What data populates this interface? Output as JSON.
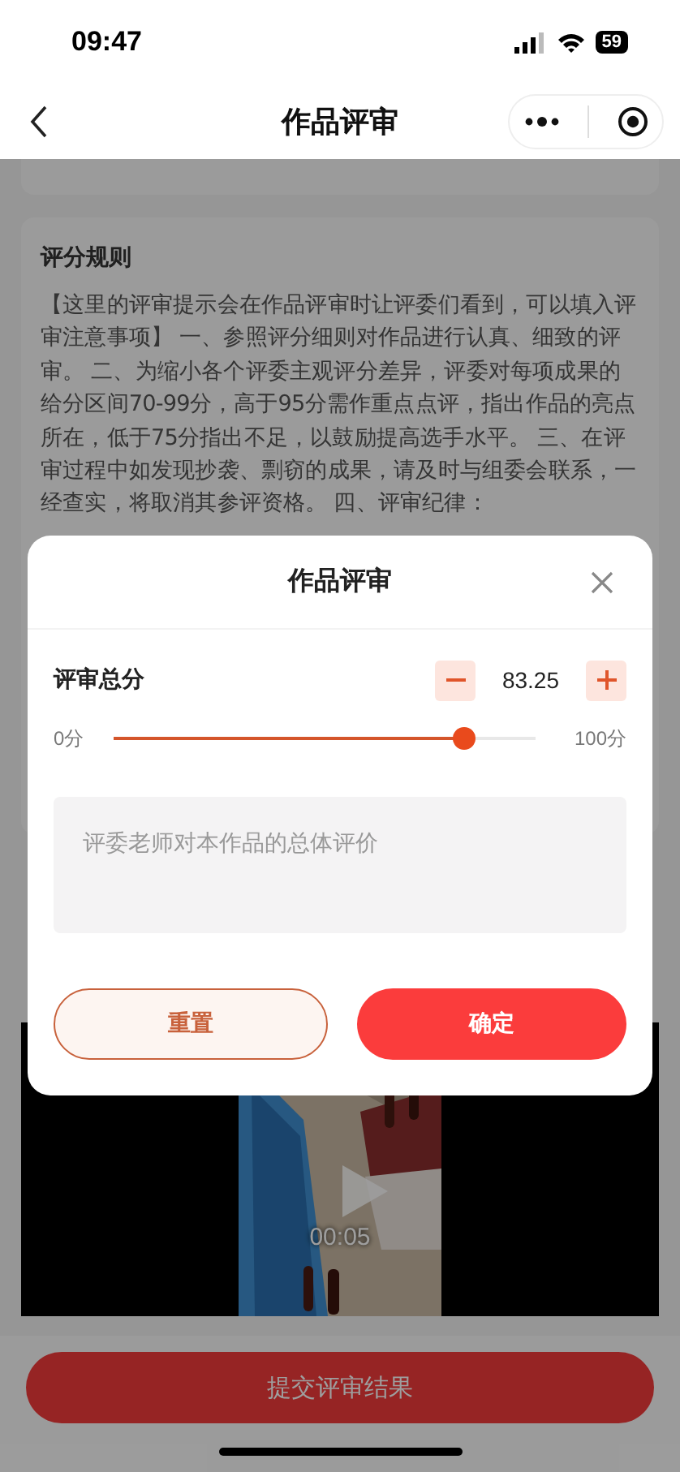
{
  "status_bar": {
    "time": "09:47",
    "battery": "59"
  },
  "nav": {
    "title": "作品评审"
  },
  "rules": {
    "title": "评分规则",
    "text": "【这里的评审提示会在作品评审时让评委们看到，可以填入评审注意事项】 一、参照评分细则对作品进行认真、细致的评审。 二、为缩小各个评委主观评分差异，评委对每项成果的给分区间70-99分，高于95分需作重点点评，指出作品的亮点所在，低于75分指出不足，以鼓励提高选手水平。 三、在评审过程中如发现抄袭、剽窃的成果，请及时与组委会联系，一经查实，将取消其参评资格。 四、评审纪律："
  },
  "video": {
    "duration": "00:05"
  },
  "submit_button": "提交评审结果",
  "dialog": {
    "title": "作品评审",
    "score_label": "评审总分",
    "score": "83.25",
    "min_label": "0分",
    "max_label": "100分",
    "level": 0.8325,
    "comment": {
      "placeholder": "评委老师对本作品的总体评价"
    },
    "buttons": [
      {
        "label": "重置",
        "kind": "secondary"
      },
      {
        "label": "确定",
        "kind": "primary"
      }
    ]
  }
}
